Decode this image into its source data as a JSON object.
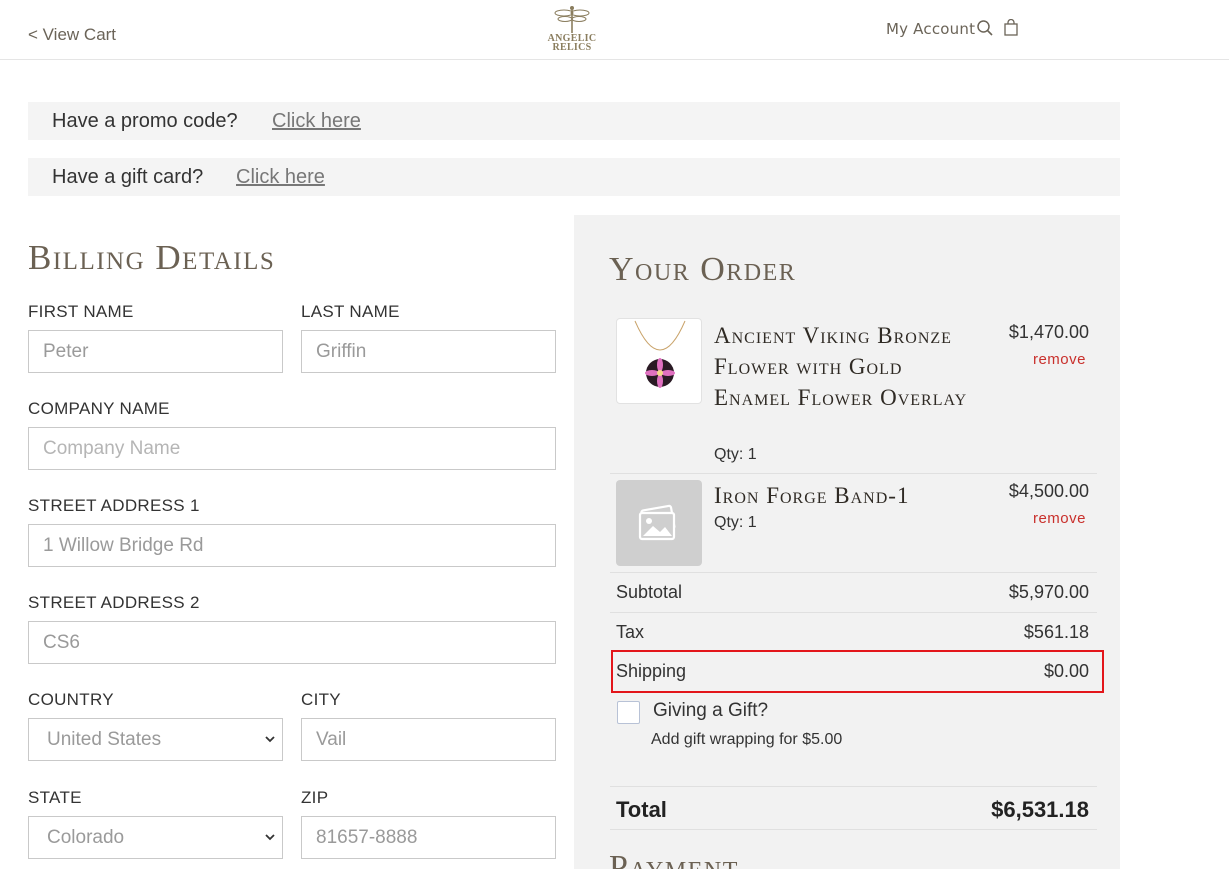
{
  "header": {
    "back_link": "< View Cart",
    "logo_line1": "ANGELIC",
    "logo_line2": "RELICS",
    "account_label": "My Account",
    "search_icon": "search-icon",
    "bag_icon": "shopping-bag-icon"
  },
  "promo": {
    "promo_label": "Have a promo code?",
    "promo_link": "Click here",
    "gift_label": "Have a gift card?",
    "gift_link": "Click here"
  },
  "billing": {
    "title": "Billing Details",
    "first_name_label": "FIRST NAME",
    "first_name_value": "Peter",
    "last_name_label": "LAST NAME",
    "last_name_value": "Griffin",
    "company_label": "COMPANY NAME",
    "company_placeholder": "Company Name",
    "street1_label": "STREET ADDRESS 1",
    "street1_value": "1 Willow Bridge Rd",
    "street2_label": "STREET ADDRESS 2",
    "street2_value": "CS6",
    "country_label": "COUNTRY",
    "country_value": "United States",
    "city_label": "CITY",
    "city_value": "Vail",
    "state_label": "STATE",
    "state_value": "Colorado",
    "zip_label": "ZIP",
    "zip_value": "81657-8888"
  },
  "order": {
    "title": "Your Order",
    "items": [
      {
        "name": "Ancient Viking Bronze Flower with Gold Enamel Flower Overlay",
        "qty": "Qty: 1",
        "price": "$1,470.00",
        "remove": "remove"
      },
      {
        "name": "Iron Forge Band-1",
        "qty": "Qty: 1",
        "price": "$4,500.00",
        "remove": "remove"
      }
    ],
    "subtotal_label": "Subtotal",
    "subtotal_value": "$5,970.00",
    "tax_label": "Tax",
    "tax_value": "$561.18",
    "shipping_label": "Shipping",
    "shipping_value": "$0.00",
    "gift_label": "Giving a Gift?",
    "gift_sub": "Add gift wrapping for $5.00",
    "total_label": "Total",
    "total_value": "$6,531.18",
    "payment_title": "Payment"
  },
  "colors": {
    "accent_brown": "#6b6153",
    "remove_red": "#c9302c",
    "highlight_red": "#e3161b",
    "panel_bg": "#f2f2f2"
  }
}
